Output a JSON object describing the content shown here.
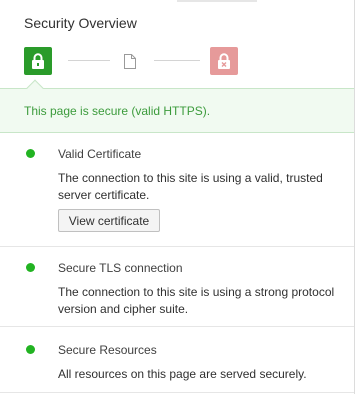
{
  "title": "Security Overview",
  "banner": {
    "text": "This page is secure (valid HTTPS)."
  },
  "sections": [
    {
      "title": "Valid Certificate",
      "description": "The connection to this site is using a valid, trusted server certificate.",
      "button_label": "View certificate",
      "status_color": "#22b322"
    },
    {
      "title": "Secure TLS connection",
      "description": "The connection to this site is using a strong protocol version and cipher suite.",
      "status_color": "#22b322"
    },
    {
      "title": "Secure Resources",
      "description": "All resources on this page are served securely.",
      "status_color": "#22b322"
    }
  ],
  "colors": {
    "secure_green": "#2a9b2a",
    "insecure_red": "#e69a9a",
    "banner_bg": "#f1faf1",
    "banner_text": "#3c9b3c"
  },
  "icons": [
    "lock-secure-icon",
    "document-icon",
    "lock-insecure-icon"
  ]
}
